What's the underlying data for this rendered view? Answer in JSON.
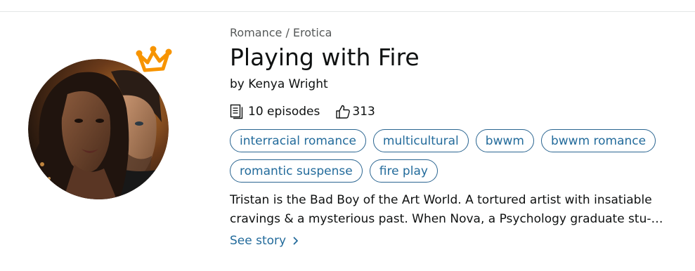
{
  "story": {
    "category": "Romance / Erotica",
    "title": "Playing with Fire",
    "author": "by Kenya Wright",
    "episodes": "10 episodes",
    "likes": "313",
    "tags": [
      "interracial romance",
      "multicultural",
      "bwwm",
      "bwwm romance",
      "romantic suspense",
      "fire play"
    ],
    "blurb": "Tristan is the Bad Boy of the Art World. A tortured artist with insatiable cravings & a mysterious past. When Nova, a Psychology graduate stu-…",
    "see_story": "See story"
  },
  "icons": {
    "crown": "crown-icon",
    "episodes": "episodes-icon",
    "likes": "thumbs-up-icon",
    "chevron": "chevron-right-icon"
  },
  "colors": {
    "accent": "#236b9b",
    "crown": "#f79400",
    "text": "#0f1111",
    "muted": "#565959"
  }
}
